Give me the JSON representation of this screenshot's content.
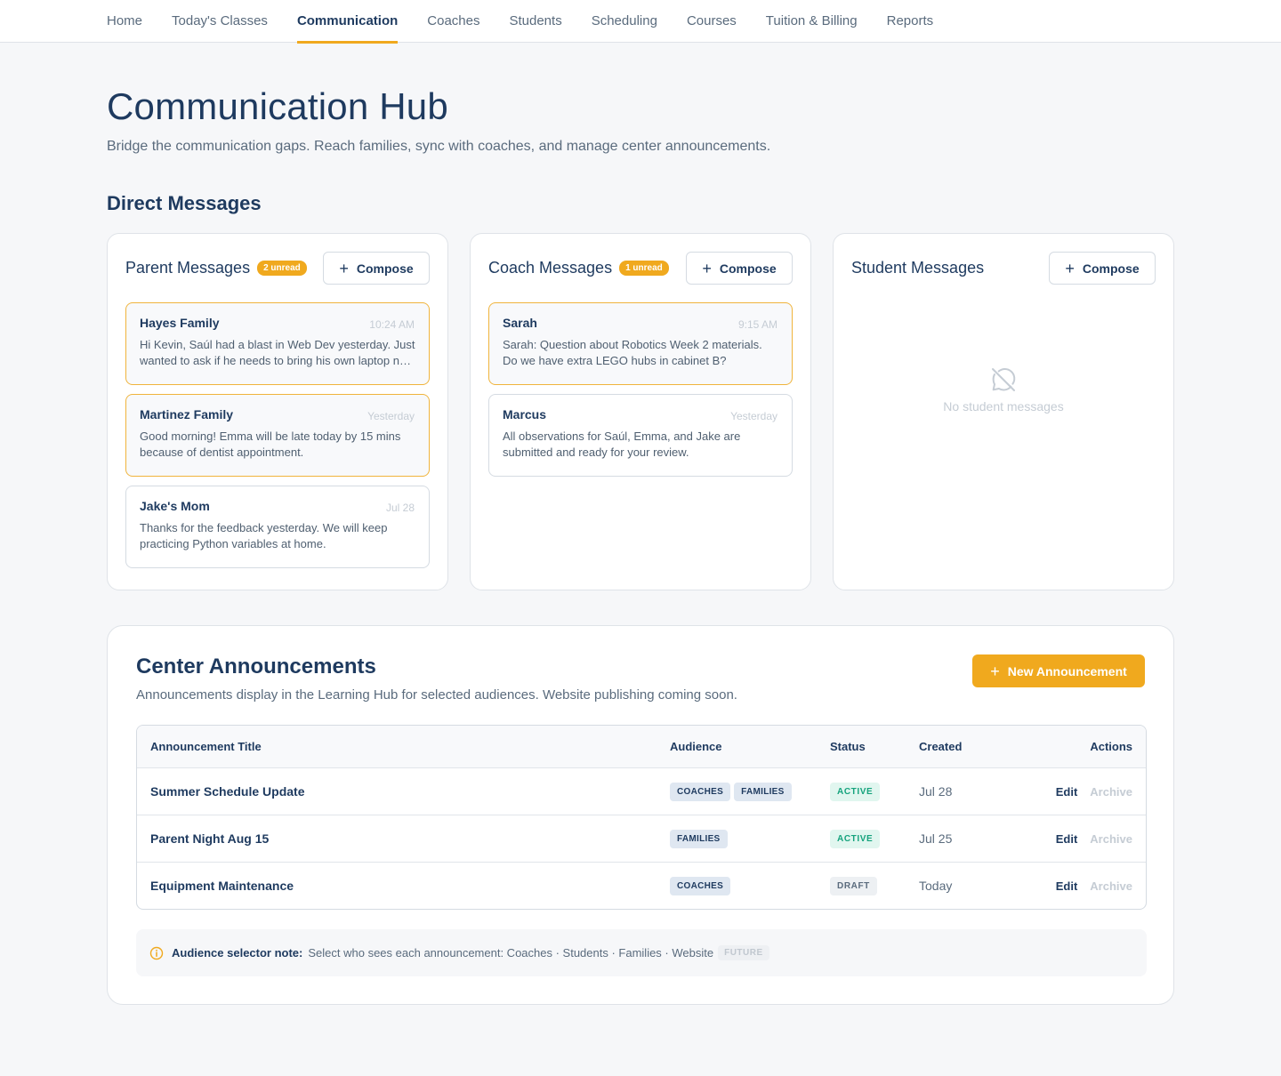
{
  "nav": {
    "items": [
      "Home",
      "Today's Classes",
      "Communication",
      "Coaches",
      "Students",
      "Scheduling",
      "Courses",
      "Tuition & Billing",
      "Reports"
    ],
    "active": "Communication"
  },
  "page": {
    "title": "Communication Hub",
    "subtitle": "Bridge the communication gaps. Reach families, sync with coaches, and manage center announcements.",
    "section_title": "Direct Messages"
  },
  "columns": {
    "parent": {
      "title": "Parent Messages",
      "unread": "2 unread",
      "compose": "Compose",
      "messages": [
        {
          "name": "Hayes Family",
          "time": "10:24 AM",
          "text": "Hi Kevin, Saúl had a blast in Web Dev yesterday. Just wanted to ask if he needs to bring his own laptop next week?",
          "unread": true
        },
        {
          "name": "Martinez Family",
          "time": "Yesterday",
          "text": "Good morning! Emma will be late today by 15 mins because of dentist appointment.",
          "unread": true
        },
        {
          "name": "Jake's Mom",
          "time": "Jul 28",
          "text": "Thanks for the feedback yesterday. We will keep practicing Python variables at home.",
          "unread": false
        }
      ]
    },
    "coach": {
      "title": "Coach Messages",
      "unread": "1 unread",
      "compose": "Compose",
      "messages": [
        {
          "name": "Sarah",
          "time": "9:15 AM",
          "text": "Sarah: Question about Robotics Week 2 materials. Do we have extra LEGO hubs in cabinet B?",
          "unread": true
        },
        {
          "name": "Marcus",
          "time": "Yesterday",
          "text": "All observations for Saúl, Emma, and Jake are submitted and ready for your review.",
          "unread": false
        }
      ]
    },
    "student": {
      "title": "Student Messages",
      "compose": "Compose",
      "empty": "No student messages",
      "empty_icon": "chat-off-icon"
    }
  },
  "announcements": {
    "title": "Center Announcements",
    "subtitle": "Announcements display in the Learning Hub for selected audiences. Website publishing coming soon.",
    "new_button": "New Announcement",
    "columns": {
      "title": "Announcement Title",
      "audience": "Audience",
      "status": "Status",
      "created": "Created",
      "actions": "Actions"
    },
    "rows": [
      {
        "title": "Summer Schedule Update",
        "audience": [
          "COACHES",
          "FAMILIES"
        ],
        "status": "ACTIVE",
        "created": "Jul 28",
        "edit": "Edit",
        "archive": "Archive"
      },
      {
        "title": "Parent Night Aug 15",
        "audience": [
          "FAMILIES"
        ],
        "status": "ACTIVE",
        "created": "Jul 25",
        "edit": "Edit",
        "archive": "Archive"
      },
      {
        "title": "Equipment Maintenance",
        "audience": [
          "COACHES"
        ],
        "status": "DRAFT",
        "created": "Today",
        "edit": "Edit",
        "archive": "Archive"
      }
    ],
    "note": {
      "label": "Audience selector note:",
      "text": "Select who sees each announcement: Coaches · Students · Families · Website",
      "badge": "FUTURE",
      "icon": "info-icon"
    }
  },
  "colors": {
    "accent": "#f0a91e",
    "primary_text": "#1e3a5f",
    "muted_text": "#5a6b7d",
    "active_status": "#15a37d",
    "background": "#f6f7f9"
  }
}
